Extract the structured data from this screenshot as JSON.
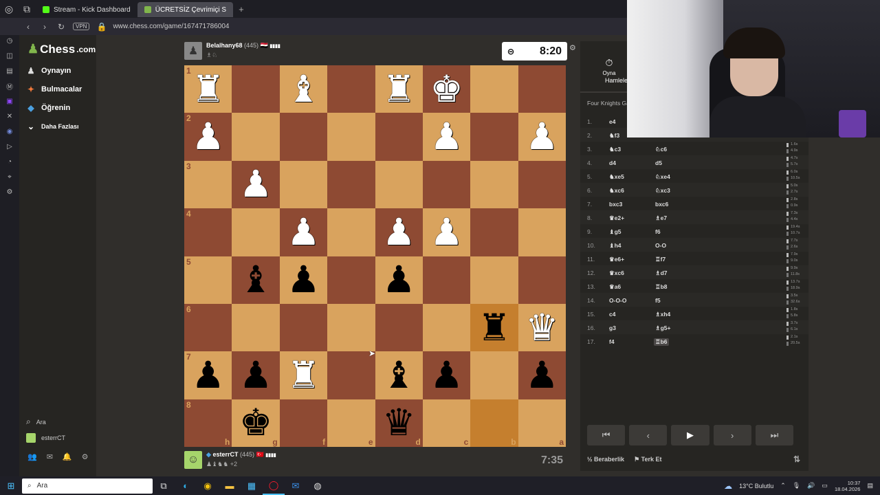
{
  "browser": {
    "tabs": [
      {
        "label": "Stream - Kick Dashboard",
        "icon": "kick-icon",
        "color": "#53fc18",
        "active": false
      },
      {
        "label": "ÜCRETSİZ Çevrimiçi S",
        "icon": "chess-icon",
        "color": "#81b64c",
        "active": true
      }
    ],
    "new_tab": "+",
    "vpn": "VPN",
    "url": "www.chess.com/game/167471786004"
  },
  "sidebar": {
    "logo": "Chess",
    "logo_suffix": ".com",
    "items": [
      {
        "label": "Oynayın",
        "icon": "play-icon",
        "glyph": "♟"
      },
      {
        "label": "Bulmacalar",
        "icon": "puzzle-icon",
        "glyph": "✦"
      },
      {
        "label": "Öğrenin",
        "icon": "learn-icon",
        "glyph": "🎓"
      },
      {
        "label": "Daha Fazlası",
        "icon": "chevron-down-icon",
        "glyph": "⌄"
      }
    ],
    "search": "Ara",
    "user": "esterrCT"
  },
  "top_player": {
    "name": "Belalhany68",
    "rating": "(445)",
    "flag": "🇪🇬",
    "signal": "▮▮▮▮",
    "captured": "♗♘",
    "clock": "8:20"
  },
  "bottom_player": {
    "name": "esterrCT",
    "rating": "(445)",
    "flag": "🇹🇷",
    "signal": "▮▮▮▮",
    "captured": "♟♝♞♞",
    "advantage": "+2",
    "clock": "7:35"
  },
  "board": {
    "ranks": [
      "1",
      "2",
      "3",
      "4",
      "5",
      "6",
      "7",
      "8"
    ],
    "files": [
      "h",
      "g",
      "f",
      "e",
      "d",
      "c",
      "b",
      "a"
    ],
    "position": [
      [
        "wR",
        "",
        "wB",
        "",
        "wR",
        "wK",
        "",
        ""
      ],
      [
        "wP",
        "",
        "",
        "",
        "",
        "wP",
        "",
        "wP"
      ],
      [
        "",
        "wP",
        "",
        "",
        "",
        "",
        "",
        ""
      ],
      [
        "",
        "",
        "wP",
        "",
        "wP",
        "wP",
        "",
        ""
      ],
      [
        "",
        "bB",
        "bP",
        "",
        "bP",
        "",
        "",
        ""
      ],
      [
        "",
        "",
        "",
        "",
        "",
        "",
        "bR",
        "wQ"
      ],
      [
        "bP",
        "bP",
        "wR",
        "",
        "bB",
        "bP",
        "",
        "bP"
      ],
      [
        "",
        "bK",
        "",
        "",
        "bQ",
        "",
        "",
        ""
      ]
    ],
    "highlight": [
      [
        5,
        6
      ],
      [
        7,
        6
      ]
    ]
  },
  "panel": {
    "play_tab": "Oyna",
    "moves_tab": "Hamlele",
    "opening": "Four Knights Ga",
    "moves": [
      {
        "n": "1.",
        "w": "e4",
        "b": "",
        "tw": "",
        "tb": ""
      },
      {
        "n": "2.",
        "w": "♞f3",
        "b": "",
        "tw": "",
        "tb": ""
      },
      {
        "n": "3.",
        "w": "♞c3",
        "b": "♘c6",
        "tw": "1.6s",
        "tb": "4.9s"
      },
      {
        "n": "4.",
        "w": "d4",
        "b": "d5",
        "tw": "4.7s",
        "tb": "5.7s"
      },
      {
        "n": "5.",
        "w": "♞xe5",
        "b": "♘xe4",
        "tw": "6.0s",
        "tb": "10.5s"
      },
      {
        "n": "6.",
        "w": "♞xc6",
        "b": "♘xc3",
        "tw": "5.0s",
        "tb": "2.7s"
      },
      {
        "n": "7.",
        "w": "bxc3",
        "b": "bxc6",
        "tw": "2.8s",
        "tb": "0.9s"
      },
      {
        "n": "8.",
        "w": "♛e2+",
        "b": "♗e7",
        "tw": "7.3s",
        "tb": "4.4s"
      },
      {
        "n": "9.",
        "w": "♝g5",
        "b": "f6",
        "tw": "19.4s",
        "tb": "10.7s"
      },
      {
        "n": "10.",
        "w": "♝h4",
        "b": "O-O",
        "tw": "7.7s",
        "tb": "2.6s"
      },
      {
        "n": "11.",
        "w": "♛e6+",
        "b": "♖f7",
        "tw": "7.9s",
        "tb": "9.0s"
      },
      {
        "n": "12.",
        "w": "♛xc6",
        "b": "♗d7",
        "tw": "9.9s",
        "tb": "11.8s"
      },
      {
        "n": "13.",
        "w": "♛a6",
        "b": "♖b8",
        "tw": "13.7s",
        "tb": "18.9s"
      },
      {
        "n": "14.",
        "w": "O-O-O",
        "b": "f5",
        "tw": "3.5s",
        "tb": "32.6s"
      },
      {
        "n": "15.",
        "w": "c4",
        "b": "♗xh4",
        "tw": "1.8s",
        "tb": "5.8s"
      },
      {
        "n": "16.",
        "w": "g3",
        "b": "♗g5+",
        "tw": "3.7s",
        "tb": "6.1s"
      },
      {
        "n": "17.",
        "w": "f4",
        "b": "♖b6",
        "tw": "2.1s",
        "tb": "20.5s"
      }
    ],
    "draw": "Beraberlik",
    "resign": "Terk Et",
    "draw_icon": "½"
  },
  "taskbar": {
    "search": "Ara",
    "weather": "13°C  Bulutlu",
    "time": "10:37",
    "date": "18.04.2026"
  }
}
